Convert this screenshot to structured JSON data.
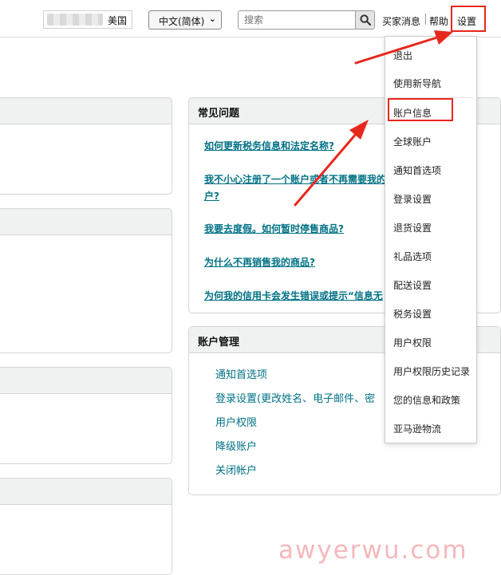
{
  "header": {
    "store_suffix": "美国",
    "language_selected": "中文(简体)",
    "search_placeholder": "搜索",
    "buyer_messages": "买家消息",
    "help": "帮助",
    "settings": "设置"
  },
  "faq": {
    "title": "常见问题",
    "links": [
      "如何更新税务信息和法定名称?",
      "我不小心注册了一个账户或者不再需要我的",
      "户?",
      "我要去度假。如何暂时停售商品?",
      "为什么不再销售我的商品?",
      "为何我的信用卡会发生错误或提示“信息无"
    ]
  },
  "account_mgmt": {
    "title": "账户管理",
    "links": [
      "通知首选项",
      "登录设置(更改姓名、电子邮件、密",
      "用户权限",
      "降级账户",
      "关闭帐户"
    ]
  },
  "settings_menu": {
    "items": [
      "退出",
      "使用新导航",
      "账户信息",
      "全球账户",
      "通知首选项",
      "登录设置",
      "退货设置",
      "礼品选项",
      "配送设置",
      "税务设置",
      "用户权限",
      "用户权限历史记录",
      "您的信息和政策",
      "亚马逊物流"
    ]
  },
  "watermark": "awyerwu.com",
  "colors": {
    "link": "#007185",
    "highlight": "#e8271c",
    "card_header_bg": "#f0f2f2"
  }
}
